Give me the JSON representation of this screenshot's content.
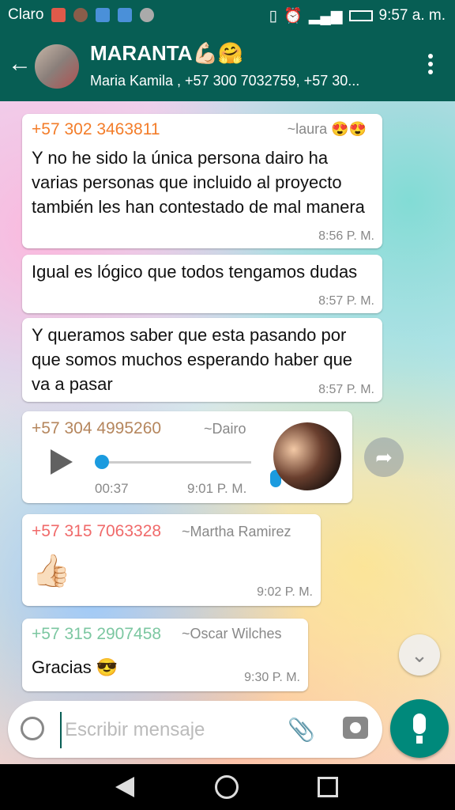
{
  "status_bar": {
    "carrier": "Claro",
    "time": "9:57 a. m."
  },
  "header": {
    "title": "MARANTA💪🏻🤗",
    "subtitle": "Maria Kamila , +57 300 7032759, +57 30..."
  },
  "messages": [
    {
      "sender": "+57 302 3463811",
      "sender_color": "#f37d2a",
      "alias": "~laura 😍😍",
      "text": "Y no he sido la única persona dairo ha varias personas que incluido al proyecto también les han contestado de mal manera",
      "time": "8:56 P. M."
    },
    {
      "text": "Igual es lógico que todos tengamos dudas",
      "time": "8:57 P. M."
    },
    {
      "text": "Y queramos saber que esta pasando por que somos muchos esperando haber que va a pasar",
      "time": "8:57 P. M."
    },
    {
      "sender": "+57 304 4995260",
      "sender_color": "#b5865d",
      "alias": "~Dairo",
      "voice_duration": "00:37",
      "voice_progress": 0.0,
      "time": "9:01 P. M."
    },
    {
      "sender": "+57 315 7063328",
      "sender_color": "#f06a6a",
      "alias": "~Martha Ramirez",
      "text": "👍🏻",
      "time": "9:02 P. M."
    },
    {
      "sender": "+57 315 2907458",
      "sender_color": "#7cc7a1",
      "alias": "~Oscar Wilches",
      "text": "Gracias 😎",
      "time": "9:30 P. M."
    }
  ],
  "composer": {
    "placeholder": "Escribir mensaje"
  },
  "colors": {
    "app_bar": "#075e54",
    "accent": "#00897b",
    "voice_accent": "#1b9bdf"
  }
}
